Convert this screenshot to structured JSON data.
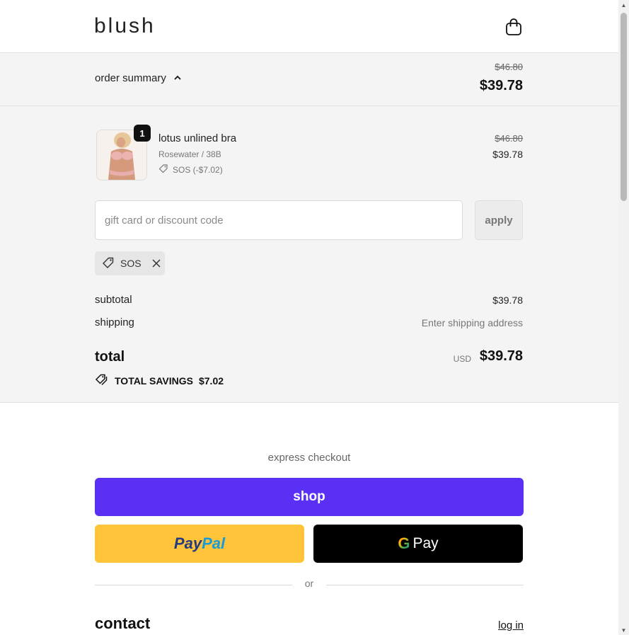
{
  "header": {
    "logo": "blush",
    "bag_icon": "shopping-bag-icon"
  },
  "summary_bar": {
    "toggle_label": "order summary",
    "chevron_icon": "chevron-up-icon",
    "original_price": "$46.80",
    "price": "$39.78"
  },
  "line_item": {
    "quantity": "1",
    "name": "lotus unlined bra",
    "variant": "Rosewater / 38B",
    "discount": "SOS (-$7.02)",
    "original_price": "$46.80",
    "price": "$39.78"
  },
  "discount_form": {
    "placeholder": "gift card or discount code",
    "apply_label": "apply"
  },
  "applied_code": {
    "code": "SOS"
  },
  "totals": {
    "subtotal_label": "subtotal",
    "subtotal_value": "$39.78",
    "shipping_label": "shipping",
    "shipping_value": "Enter shipping address",
    "total_label": "total",
    "currency": "USD",
    "total_value": "$39.78",
    "savings_label": "TOTAL SAVINGS",
    "savings_value": "$7.02"
  },
  "express": {
    "label": "express checkout",
    "shop_label": "shop",
    "paypal_part1": "Pay",
    "paypal_part2": "Pal",
    "gpay_g": "G",
    "gpay_label": "Pay",
    "or_label": "or"
  },
  "contact": {
    "title": "contact",
    "login_label": "log in"
  },
  "colors": {
    "shop_pay": "#5a31f4",
    "paypal": "#ffc439",
    "gpay": "#000000",
    "panel_bg": "#f4f4f4"
  }
}
